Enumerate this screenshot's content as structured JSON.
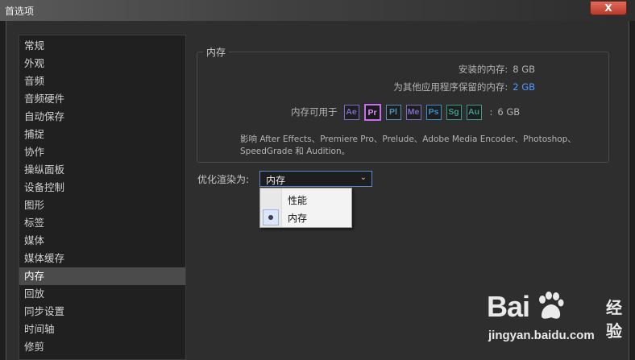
{
  "window": {
    "title": "首选项",
    "close_label": "X"
  },
  "sidebar": {
    "items": [
      {
        "label": "常规"
      },
      {
        "label": "外观"
      },
      {
        "label": "音频"
      },
      {
        "label": "音频硬件"
      },
      {
        "label": "自动保存"
      },
      {
        "label": "捕捉"
      },
      {
        "label": "协作"
      },
      {
        "label": "操纵面板"
      },
      {
        "label": "设备控制"
      },
      {
        "label": "图形"
      },
      {
        "label": "标签"
      },
      {
        "label": "媒体"
      },
      {
        "label": "媒体缓存"
      },
      {
        "label": "内存"
      },
      {
        "label": "回放"
      },
      {
        "label": "同步设置"
      },
      {
        "label": "时间轴"
      },
      {
        "label": "修剪"
      }
    ],
    "selected_index": 13
  },
  "memory": {
    "group_title": "内存",
    "installed_label": "安装的内存:",
    "installed_value": "8 GB",
    "reserved_label": "为其他应用程序保留的内存:",
    "reserved_value": "2 GB",
    "available_label": "内存可用于",
    "available_sep": ":",
    "available_value": "6 GB",
    "apps": [
      {
        "abbr": "Ae",
        "color": "#7d6bc8",
        "selected": false
      },
      {
        "abbr": "Pr",
        "color": "#c76bf0",
        "selected": true
      },
      {
        "abbr": "Pl",
        "color": "#4f8fb8",
        "selected": false
      },
      {
        "abbr": "Me",
        "color": "#7a6cc4",
        "selected": false
      },
      {
        "abbr": "Ps",
        "color": "#3a8fc8",
        "selected": false
      },
      {
        "abbr": "Sg",
        "color": "#3a9a8a",
        "selected": false
      },
      {
        "abbr": "Au",
        "color": "#3a9a90",
        "selected": false
      }
    ],
    "description": "影响 After Effects、Premiere Pro、Prelude、Adobe Media Encoder、Photoshop、SpeedGrade 和 Audition。"
  },
  "render": {
    "label": "优化渲染为:",
    "selected_value": "内存",
    "options": [
      {
        "label": "性能",
        "checked": false
      },
      {
        "label": "内存",
        "checked": true
      }
    ]
  },
  "watermark": {
    "brand": "Bai",
    "brand2": "经验",
    "url": "jingyan.baidu.com"
  }
}
